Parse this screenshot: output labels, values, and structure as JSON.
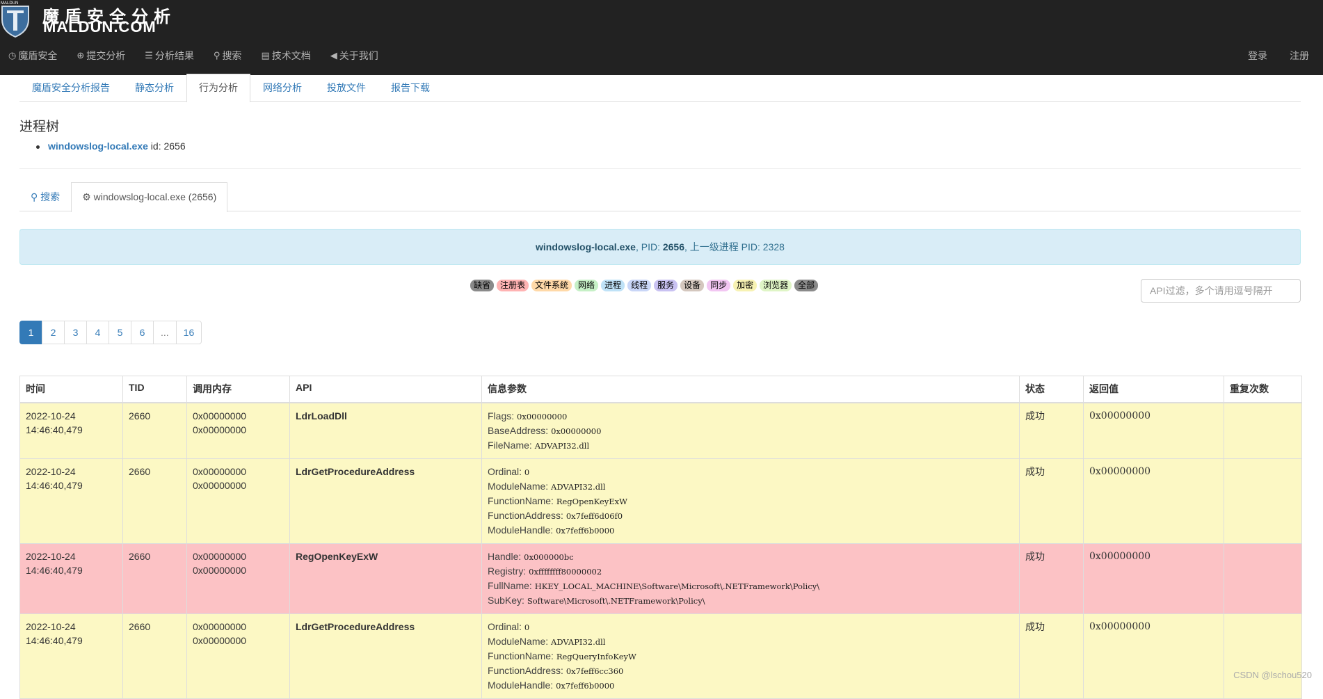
{
  "brand": {
    "small_logo_text": "MALDUN",
    "title_cn": "魔盾安全分析",
    "title_en": "MALDUN.COM"
  },
  "nav": {
    "left": [
      {
        "label": "魔盾安全",
        "icon": "clock-icon",
        "glyph": "◷"
      },
      {
        "label": "提交分析",
        "icon": "upload-icon",
        "glyph": "⊕"
      },
      {
        "label": "分析结果",
        "icon": "list-icon",
        "glyph": "☰"
      },
      {
        "label": "搜索",
        "icon": "search-icon",
        "glyph": "⚲"
      },
      {
        "label": "技术文档",
        "icon": "document-icon",
        "glyph": "▤"
      },
      {
        "label": "关于我们",
        "icon": "megaphone-icon",
        "glyph": "◀"
      }
    ],
    "right": [
      {
        "label": "登录"
      },
      {
        "label": "注册"
      }
    ]
  },
  "report_tabs": [
    {
      "label": "魔盾安全分析报告",
      "active": false
    },
    {
      "label": "静态分析",
      "active": false
    },
    {
      "label": "行为分析",
      "active": true
    },
    {
      "label": "网络分析",
      "active": false
    },
    {
      "label": "投放文件",
      "active": false
    },
    {
      "label": "报告下载",
      "active": false
    }
  ],
  "process_tree": {
    "title": "进程树",
    "items": [
      {
        "name": "windowslog-local.exe",
        "id_text": " id: 2656"
      }
    ]
  },
  "process_tabs": {
    "search_label": "搜索",
    "process_label": "windowslog-local.exe (2656)"
  },
  "process_info": {
    "name": "windowslog-local.exe",
    "pid_label": ", PID: ",
    "pid": "2656",
    "parent_label": ", 上一级进程 PID: 2328"
  },
  "categories": [
    {
      "label": "缺省",
      "color": "#8a8a8a"
    },
    {
      "label": "注册表",
      "color": "#ffb3b3"
    },
    {
      "label": "文件系统",
      "color": "#ffd9a8"
    },
    {
      "label": "网络",
      "color": "#c6f0c6"
    },
    {
      "label": "进程",
      "color": "#bfe2f7"
    },
    {
      "label": "线程",
      "color": "#c9d6f7"
    },
    {
      "label": "服务",
      "color": "#c9c2f2"
    },
    {
      "label": "设备",
      "color": "#d4c7be"
    },
    {
      "label": "同步",
      "color": "#f2c6f2"
    },
    {
      "label": "加密",
      "color": "#f7f2b3"
    },
    {
      "label": "浏览器",
      "color": "#dff5c6"
    },
    {
      "label": "全部",
      "color": "#8a8a8a"
    }
  ],
  "api_filter": {
    "placeholder": "API过滤，多个请用逗号隔开",
    "value": ""
  },
  "pagination": [
    "1",
    "2",
    "3",
    "4",
    "5",
    "6",
    "...",
    "16"
  ],
  "table": {
    "headers": [
      "时间",
      "TID",
      "调用内存",
      "API",
      "信息参数",
      "状态",
      "返回值",
      "重复次数"
    ],
    "rows": [
      {
        "type": "yellow",
        "time": "2022-10-24\n14:46:40,479",
        "tid": "2660",
        "mem": "0x00000000\n0x00000000",
        "api": "LdrLoadDll",
        "args": [
          {
            "k": "Flags: ",
            "v": "0x00000000"
          },
          {
            "k": "BaseAddress: ",
            "v": "0x00000000"
          },
          {
            "k": "FileName: ",
            "v": "ADVAPI32.dll"
          }
        ],
        "status": "成功",
        "ret": "0x00000000",
        "repeat": ""
      },
      {
        "type": "yellow",
        "time": "2022-10-24\n14:46:40,479",
        "tid": "2660",
        "mem": "0x00000000\n0x00000000",
        "api": "LdrGetProcedureAddress",
        "args": [
          {
            "k": "Ordinal: ",
            "v": "0"
          },
          {
            "k": "ModuleName: ",
            "v": "ADVAPI32.dll"
          },
          {
            "k": "FunctionName: ",
            "v": "RegOpenKeyExW"
          },
          {
            "k": "FunctionAddress: ",
            "v": "0x7feff6d06f0"
          },
          {
            "k": "ModuleHandle: ",
            "v": "0x7feff6b0000"
          }
        ],
        "status": "成功",
        "ret": "0x00000000",
        "repeat": ""
      },
      {
        "type": "red",
        "time": "2022-10-24\n14:46:40,479",
        "tid": "2660",
        "mem": "0x00000000\n0x00000000",
        "api": "RegOpenKeyExW",
        "args": [
          {
            "k": "Handle: ",
            "v": "0x000000bc"
          },
          {
            "k": "Registry: ",
            "v": "0xffffffff80000002"
          },
          {
            "k": "FullName: ",
            "v": "HKEY_LOCAL_MACHINE\\Software\\Microsoft\\.NETFramework\\Policy\\"
          },
          {
            "k": "SubKey: ",
            "v": "Software\\Microsoft\\.NETFramework\\Policy\\"
          }
        ],
        "status": "成功",
        "ret": "0x00000000",
        "repeat": ""
      },
      {
        "type": "yellow",
        "time": "2022-10-24\n14:46:40,479",
        "tid": "2660",
        "mem": "0x00000000\n0x00000000",
        "api": "LdrGetProcedureAddress",
        "args": [
          {
            "k": "Ordinal: ",
            "v": "0"
          },
          {
            "k": "ModuleName: ",
            "v": "ADVAPI32.dll"
          },
          {
            "k": "FunctionName: ",
            "v": "RegQueryInfoKeyW"
          },
          {
            "k": "FunctionAddress: ",
            "v": "0x7feff6cc360"
          },
          {
            "k": "ModuleHandle: ",
            "v": "0x7feff6b0000"
          }
        ],
        "status": "成功",
        "ret": "0x00000000",
        "repeat": ""
      }
    ]
  },
  "watermark": "CSDN @lschou520"
}
